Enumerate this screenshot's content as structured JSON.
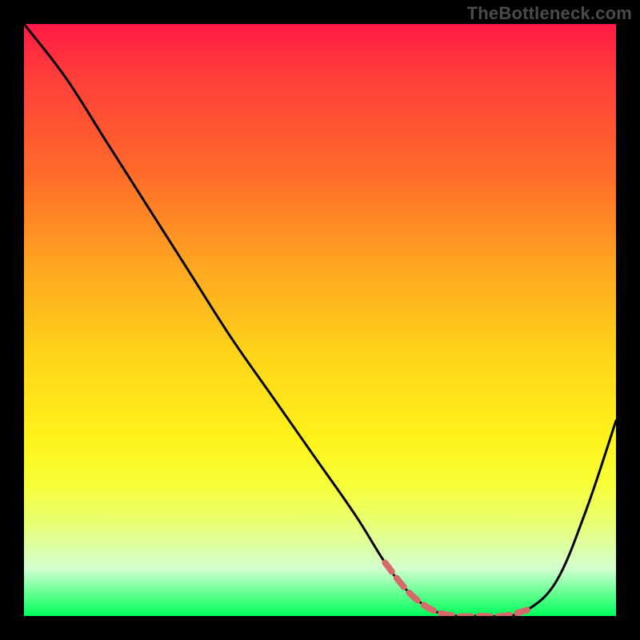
{
  "watermark": "TheBottleneck.com",
  "chart_data": {
    "type": "line",
    "title": "",
    "xlabel": "",
    "ylabel": "",
    "xlim": [
      0,
      100
    ],
    "ylim": [
      0,
      100
    ],
    "legend": false,
    "grid": false,
    "series": [
      {
        "name": "bottleneck-curve",
        "color": "#000000",
        "x": [
          0,
          7,
          14,
          21,
          28,
          35,
          42,
          49,
          56,
          61,
          65,
          69,
          73,
          77,
          81,
          85,
          90,
          95,
          100
        ],
        "values": [
          100,
          91,
          80,
          69,
          58,
          47,
          37,
          27,
          17,
          9,
          4,
          1,
          0,
          0,
          0,
          1,
          6,
          18,
          33
        ]
      },
      {
        "name": "trough-highlight",
        "color": "#d66a6a",
        "style": "dashed",
        "x": [
          61,
          65,
          69,
          73,
          77,
          81,
          85
        ],
        "values": [
          9,
          4,
          1,
          0,
          0,
          0,
          1
        ]
      }
    ],
    "background_gradient": {
      "top": "#ff1a46",
      "mid": "#fff31a",
      "bottom": "#00ff5a"
    }
  }
}
